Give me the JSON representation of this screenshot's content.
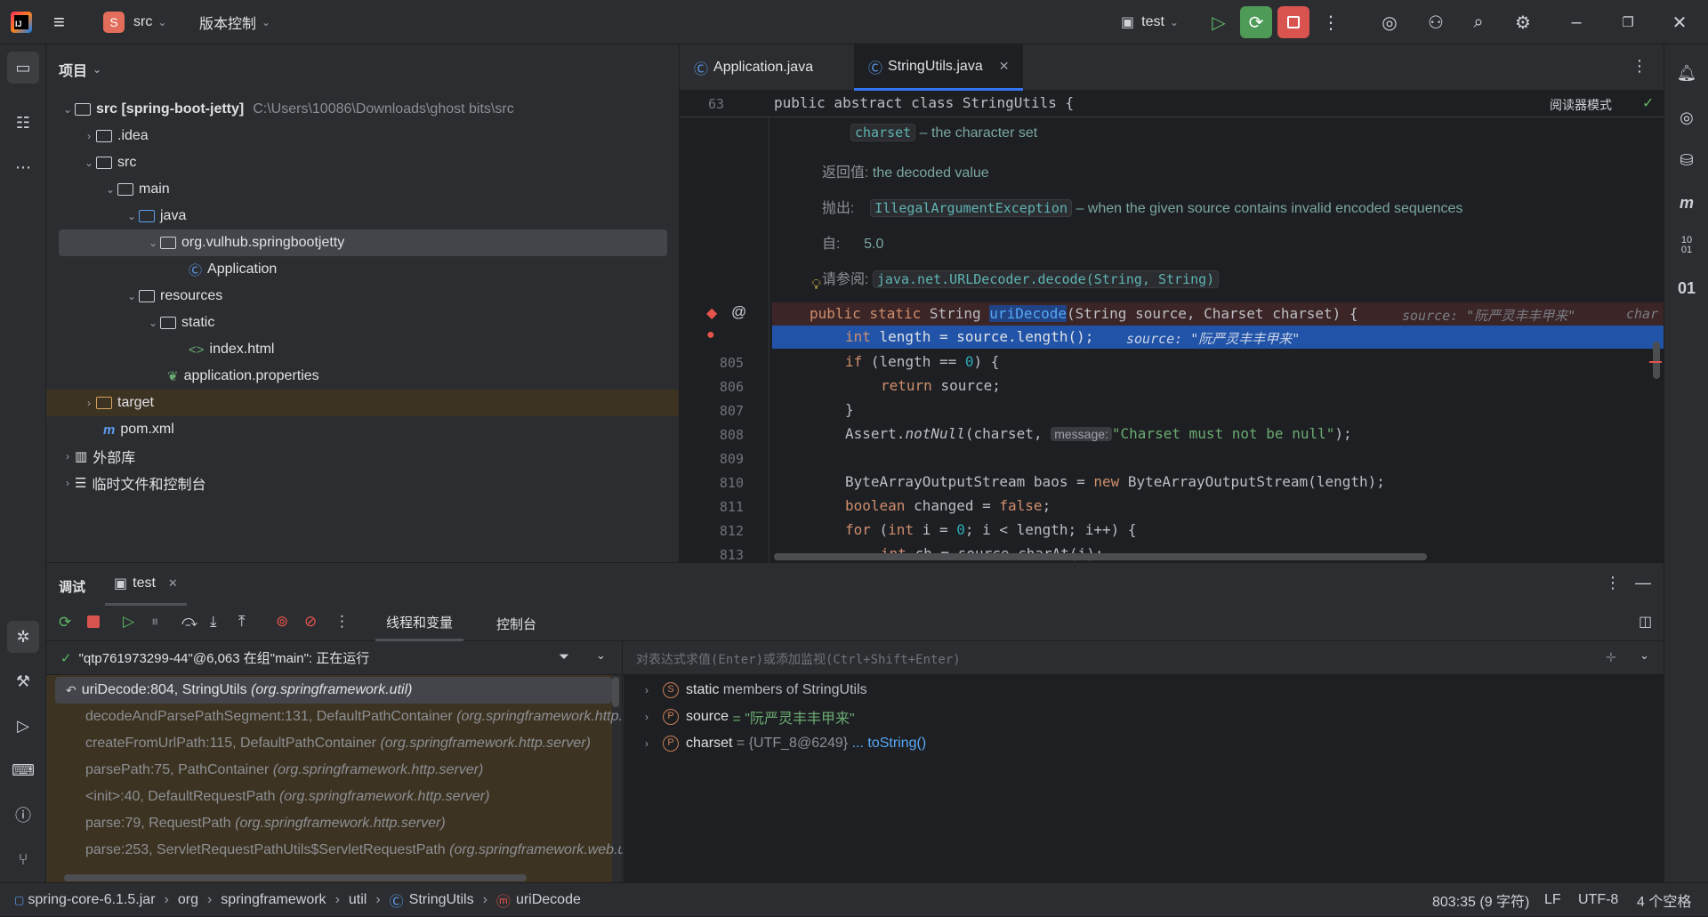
{
  "titlebar": {
    "project_badge": "S",
    "project_name": "src",
    "vcs_label": "版本控制",
    "run_config": "test"
  },
  "project_panel": {
    "title": "项目",
    "tree": [
      {
        "label": "src [spring-boot-jetty]",
        "path": "C:\\Users\\10086\\Downloads\\ghost bits\\src"
      },
      {
        "label": ".idea"
      },
      {
        "label": "src"
      },
      {
        "label": "main"
      },
      {
        "label": "java"
      },
      {
        "label": "org.vulhub.springbootjetty"
      },
      {
        "label": "Application"
      },
      {
        "label": "resources"
      },
      {
        "label": "static"
      },
      {
        "label": "index.html"
      },
      {
        "label": "application.properties"
      },
      {
        "label": "target"
      },
      {
        "label": "pom.xml"
      },
      {
        "label": "外部库"
      },
      {
        "label": "临时文件和控制台"
      }
    ]
  },
  "editor": {
    "tabs": [
      {
        "label": "Application.java"
      },
      {
        "label": "StringUtils.java"
      }
    ],
    "reader_mode": "阅读器模式",
    "sticky_line_number": "63",
    "sticky_line": "public abstract class StringUtils {",
    "doc": {
      "param_name": "charset",
      "param_desc": "– the character set",
      "returns_label": "返回值:",
      "returns_desc": "the decoded value",
      "throws_label": "抛出:",
      "throws_name": "IllegalArgumentException",
      "throws_desc": "– when the given source contains invalid encoded sequences",
      "since_label": "自:",
      "since_value": "5.0",
      "see_label": "请参阅:",
      "see_value": "java.net.URLDecoder.decode(String, String)"
    },
    "method_signature_hint_source": "source: \"阮严灵丰丰甲来\"",
    "method_signature_hint_charset": "char",
    "current_line_hint": "source: \"阮严灵丰丰甲来\"",
    "line_numbers": [
      "805",
      "806",
      "807",
      "808",
      "809",
      "810",
      "811",
      "812",
      "813"
    ],
    "message_hint": "message:"
  },
  "debug": {
    "tab_debug": "调试",
    "tab_config": "test",
    "subtab_threads": "线程和变量",
    "subtab_console": "控制台",
    "thread_status": "\"qtp761973299-44\"@6,063 在组\"main\": 正在运行",
    "eval_placeholder": "对表达式求值(Enter)或添加监视(Ctrl+Shift+Enter)",
    "frames": [
      {
        "method": "uriDecode:804, StringUtils",
        "pkg": "(org.springframework.util)"
      },
      {
        "method": "decodeAndParsePathSegment:131, DefaultPathContainer",
        "pkg": "(org.springframework.http.server)"
      },
      {
        "method": "createFromUrlPath:115, DefaultPathContainer",
        "pkg": "(org.springframework.http.server)"
      },
      {
        "method": "parsePath:75, PathContainer",
        "pkg": "(org.springframework.http.server)"
      },
      {
        "method": "<init>:40, DefaultRequestPath",
        "pkg": "(org.springframework.http.server)"
      },
      {
        "method": "parse:79, RequestPath",
        "pkg": "(org.springframework.http.server)"
      },
      {
        "method": "parse:253, ServletRequestPathUtils$ServletRequestPath",
        "pkg": "(org.springframework.web.util)"
      }
    ],
    "variables": [
      {
        "badge": "S",
        "name": "static",
        "value": "members of StringUtils"
      },
      {
        "badge": "P",
        "name": "source",
        "value": "= \"阮严灵丰丰甲来\""
      },
      {
        "badge": "P",
        "name": "charset",
        "value": "= {UTF_8@6249}",
        "link": "... toString()"
      }
    ]
  },
  "statusbar": {
    "breadcrumbs": [
      "spring-core-6.1.5.jar",
      "org",
      "springframework",
      "util",
      "StringUtils",
      "uriDecode"
    ],
    "position": "803:35 (9 字符)",
    "line_sep": "LF",
    "encoding": "UTF-8",
    "indent": "4 个空格"
  }
}
